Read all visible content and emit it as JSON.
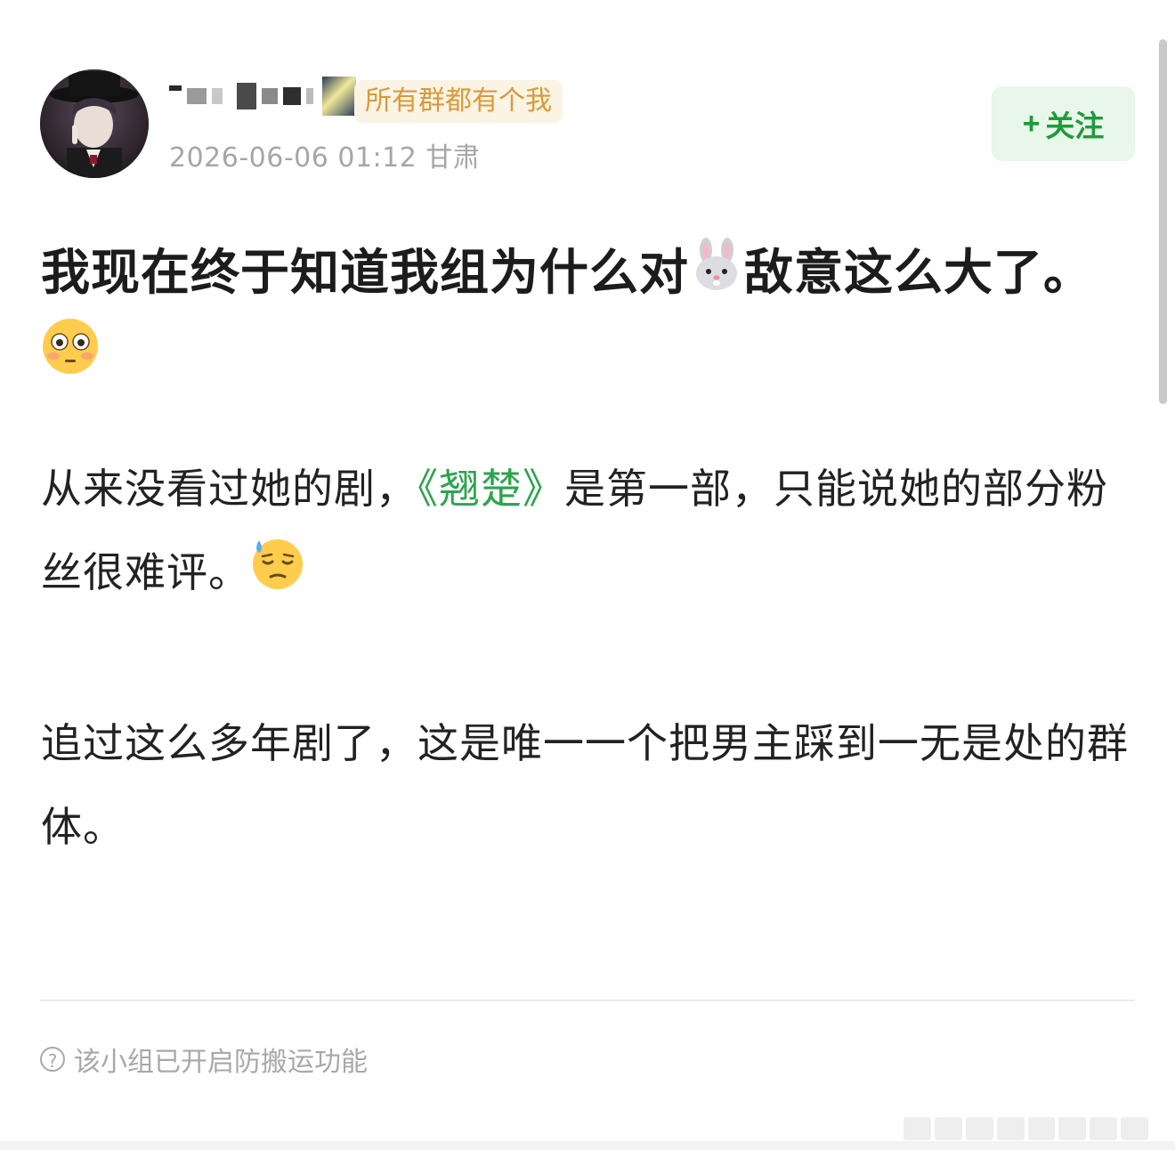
{
  "post": {
    "group_badge": "所有群都有个我",
    "timestamp": "2026-06-06 01:12",
    "location": "甘肃",
    "follow_label": "关注",
    "follow_plus": "+",
    "title_part1": "我现在终于知道我组为什么对",
    "title_part2": "敌意这么大了。",
    "title_emoji_1": "rabbit-face-emoji",
    "title_emoji_2": "flushed-face-emoji",
    "para1_part1": "从来没看过她的剧，",
    "para1_link": "《翘楚》",
    "para1_part2": "是第一部，只能说她的部分粉丝很难评。",
    "para1_emoji": "downcast-sweat-face-emoji",
    "para2": "追过这么多年剧了，这是唯一一个把男主踩到一无是处的群体。",
    "notice_icon": "question-circle-icon",
    "notice": "该小组已开启防搬运功能"
  },
  "colors": {
    "accent_green": "#2da44e",
    "follow_bg": "#e9f7ea",
    "badge_bg": "#fbf3e4",
    "badge_text": "#d99a3a",
    "meta_gray": "#a6a6a6"
  }
}
